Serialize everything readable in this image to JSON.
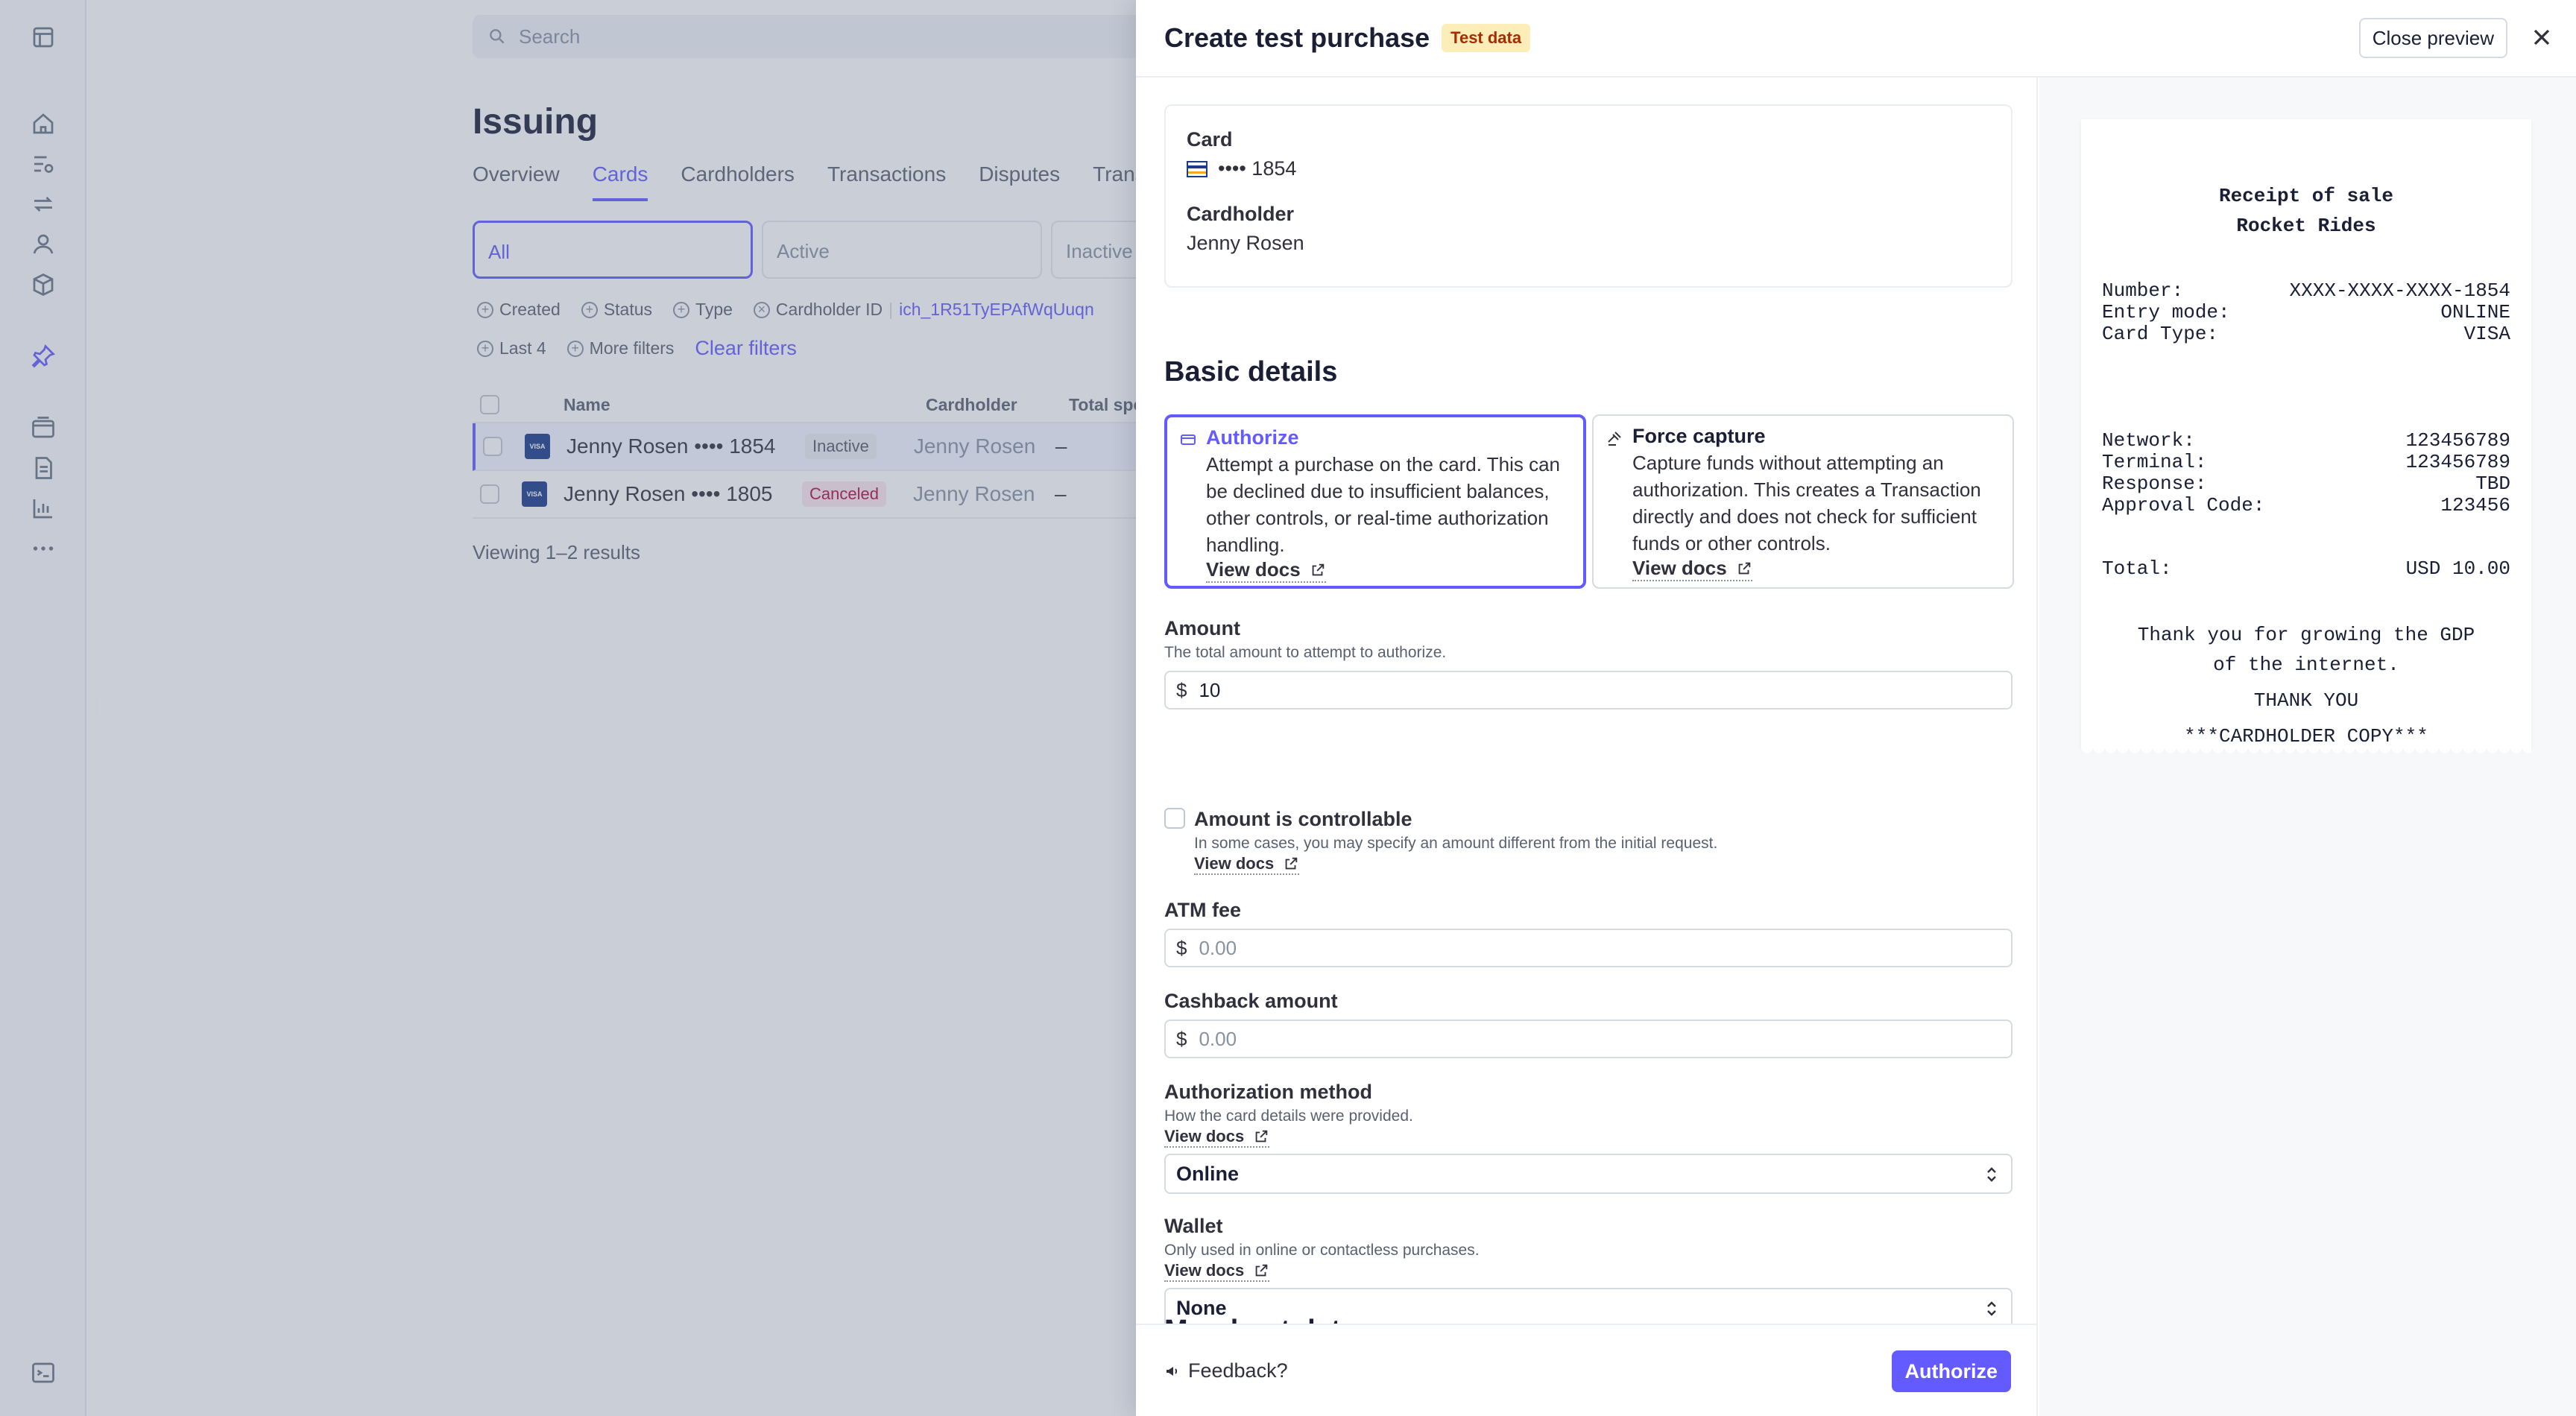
{
  "app": {
    "search_placeholder": "Search",
    "page_title": "Issuing",
    "tabs": [
      {
        "label": "Overview"
      },
      {
        "label": "Cards"
      },
      {
        "label": "Cardholders"
      },
      {
        "label": "Transactions"
      },
      {
        "label": "Disputes"
      },
      {
        "label": "Transf"
      }
    ],
    "status_cards": [
      {
        "label": "All"
      },
      {
        "label": "Active"
      },
      {
        "label": "Inactive"
      }
    ],
    "filters": {
      "created": "Created",
      "status": "Status",
      "type": "Type",
      "cardholder_id": "Cardholder ID",
      "cardholder_id_value": "ich_1R51TyEPAfWqUuqn",
      "last4": "Last 4",
      "more": "More filters",
      "clear": "Clear filters"
    },
    "table": {
      "headers": {
        "name": "Name",
        "cardholder": "Cardholder",
        "total": "Total spe"
      },
      "rows": [
        {
          "name": "Jenny Rosen •••• 1854",
          "status": "Inactive",
          "cardholder": "Jenny Rosen",
          "total": "–"
        },
        {
          "name": "Jenny Rosen •••• 1805",
          "status": "Canceled",
          "cardholder": "Jenny Rosen",
          "total": "–"
        }
      ],
      "visa_label": "VISA"
    },
    "viewing": "Viewing 1–2 results"
  },
  "drawer": {
    "title": "Create test purchase",
    "badge": "Test data",
    "close_preview": "Close preview",
    "card_label": "Card",
    "card_value": "•••• 1854",
    "cardholder_label": "Cardholder",
    "cardholder_value": "Jenny Rosen",
    "basic_details": "Basic details",
    "options": [
      {
        "title": "Authorize",
        "desc": "Attempt a purchase on the card. This can be declined due to insufficient balances, other controls, or real-time authorization handling.",
        "link": "View docs"
      },
      {
        "title": "Force capture",
        "desc": "Capture funds without attempting an authorization. This creates a Transaction directly and does not check for sufficient funds or other controls.",
        "link": "View docs"
      }
    ],
    "amount": {
      "label": "Amount",
      "help": "The total amount to attempt to authorize.",
      "currency": "$",
      "value": "10"
    },
    "controllable": {
      "label": "Amount is controllable",
      "help": "In some cases, you may specify an amount different from the initial request.",
      "link": "View docs"
    },
    "atm_fee": {
      "label": "ATM fee",
      "currency": "$",
      "placeholder": "0.00"
    },
    "cashback": {
      "label": "Cashback amount",
      "currency": "$",
      "placeholder": "0.00"
    },
    "auth_method": {
      "label": "Authorization method",
      "help": "How the card details were provided.",
      "link": "View docs",
      "value": "Online"
    },
    "wallet": {
      "label": "Wallet",
      "help": "Only used in online or contactless purchases.",
      "link": "View docs",
      "value": "None"
    },
    "next_section_peek": "Merchant data",
    "feedback": "Feedback?",
    "authorize_button": "Authorize"
  },
  "receipt": {
    "title": "Receipt of sale",
    "merchant": "Rocket Rides",
    "rows_a": [
      {
        "k": "Number:",
        "v": "XXXX-XXXX-XXXX-1854"
      },
      {
        "k": "Entry mode:",
        "v": "ONLINE"
      },
      {
        "k": "Card Type:",
        "v": "VISA"
      }
    ],
    "rows_b": [
      {
        "k": "Network:",
        "v": "123456789"
      },
      {
        "k": "Terminal:",
        "v": "123456789"
      },
      {
        "k": "Response:",
        "v": "TBD"
      },
      {
        "k": "Approval Code:",
        "v": "123456"
      }
    ],
    "total": {
      "k": "Total:",
      "v": "USD 10.00"
    },
    "thanks_1": "Thank you for growing the GDP",
    "thanks_2": "of the internet.",
    "thank_you": "THANK YOU",
    "copy": "***CARDHOLDER COPY***"
  },
  "colors": {
    "accent": "#635bff",
    "badge_bg": "#fcedb9",
    "badge_text": "#a82c00"
  }
}
